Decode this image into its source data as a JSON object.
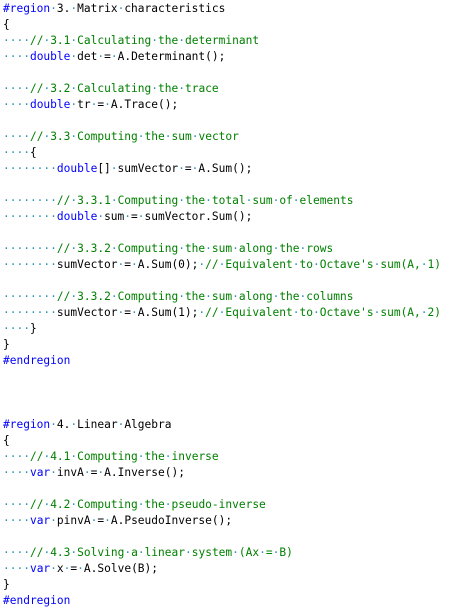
{
  "colors": {
    "keyword": "#0000ff",
    "comment": "#008000",
    "whitespace_marker": "#2b91af",
    "text": "#000000",
    "background": "#ffffff"
  },
  "lines": [
    [
      {
        "t": "kw",
        "v": "#region"
      },
      {
        "t": "ws",
        "v": "·"
      },
      {
        "t": "txt",
        "v": "3."
      },
      {
        "t": "ws",
        "v": "·"
      },
      {
        "t": "txt",
        "v": "Matrix"
      },
      {
        "t": "ws",
        "v": "·"
      },
      {
        "t": "txt",
        "v": "characteristics"
      }
    ],
    [
      {
        "t": "txt",
        "v": "{"
      }
    ],
    [
      {
        "t": "ws",
        "v": "····"
      },
      {
        "t": "cm",
        "v": "//"
      },
      {
        "t": "ws",
        "v": "·"
      },
      {
        "t": "cm",
        "v": "3.1"
      },
      {
        "t": "ws",
        "v": "·"
      },
      {
        "t": "cm",
        "v": "Calculating"
      },
      {
        "t": "ws",
        "v": "·"
      },
      {
        "t": "cm",
        "v": "the"
      },
      {
        "t": "ws",
        "v": "·"
      },
      {
        "t": "cm",
        "v": "determinant"
      }
    ],
    [
      {
        "t": "ws",
        "v": "····"
      },
      {
        "t": "kw",
        "v": "double"
      },
      {
        "t": "ws",
        "v": "·"
      },
      {
        "t": "txt",
        "v": "det"
      },
      {
        "t": "ws",
        "v": "·"
      },
      {
        "t": "txt",
        "v": "="
      },
      {
        "t": "ws",
        "v": "·"
      },
      {
        "t": "txt",
        "v": "A.Determinant();"
      }
    ],
    [],
    [
      {
        "t": "ws",
        "v": "····"
      },
      {
        "t": "cm",
        "v": "//"
      },
      {
        "t": "ws",
        "v": "·"
      },
      {
        "t": "cm",
        "v": "3.2"
      },
      {
        "t": "ws",
        "v": "·"
      },
      {
        "t": "cm",
        "v": "Calculating"
      },
      {
        "t": "ws",
        "v": "·"
      },
      {
        "t": "cm",
        "v": "the"
      },
      {
        "t": "ws",
        "v": "·"
      },
      {
        "t": "cm",
        "v": "trace"
      }
    ],
    [
      {
        "t": "ws",
        "v": "····"
      },
      {
        "t": "kw",
        "v": "double"
      },
      {
        "t": "ws",
        "v": "·"
      },
      {
        "t": "txt",
        "v": "tr"
      },
      {
        "t": "ws",
        "v": "·"
      },
      {
        "t": "txt",
        "v": "="
      },
      {
        "t": "ws",
        "v": "·"
      },
      {
        "t": "txt",
        "v": "A.Trace();"
      }
    ],
    [],
    [
      {
        "t": "ws",
        "v": "····"
      },
      {
        "t": "cm",
        "v": "//"
      },
      {
        "t": "ws",
        "v": "·"
      },
      {
        "t": "cm",
        "v": "3.3"
      },
      {
        "t": "ws",
        "v": "·"
      },
      {
        "t": "cm",
        "v": "Computing"
      },
      {
        "t": "ws",
        "v": "·"
      },
      {
        "t": "cm",
        "v": "the"
      },
      {
        "t": "ws",
        "v": "·"
      },
      {
        "t": "cm",
        "v": "sum"
      },
      {
        "t": "ws",
        "v": "·"
      },
      {
        "t": "cm",
        "v": "vector"
      }
    ],
    [
      {
        "t": "ws",
        "v": "····"
      },
      {
        "t": "txt",
        "v": "{"
      }
    ],
    [
      {
        "t": "ws",
        "v": "········"
      },
      {
        "t": "kw",
        "v": "double"
      },
      {
        "t": "txt",
        "v": "[]"
      },
      {
        "t": "ws",
        "v": "·"
      },
      {
        "t": "txt",
        "v": "sumVector"
      },
      {
        "t": "ws",
        "v": "·"
      },
      {
        "t": "txt",
        "v": "="
      },
      {
        "t": "ws",
        "v": "·"
      },
      {
        "t": "txt",
        "v": "A.Sum();"
      }
    ],
    [],
    [
      {
        "t": "ws",
        "v": "········"
      },
      {
        "t": "cm",
        "v": "//"
      },
      {
        "t": "ws",
        "v": "·"
      },
      {
        "t": "cm",
        "v": "3.3.1"
      },
      {
        "t": "ws",
        "v": "·"
      },
      {
        "t": "cm",
        "v": "Computing"
      },
      {
        "t": "ws",
        "v": "·"
      },
      {
        "t": "cm",
        "v": "the"
      },
      {
        "t": "ws",
        "v": "·"
      },
      {
        "t": "cm",
        "v": "total"
      },
      {
        "t": "ws",
        "v": "·"
      },
      {
        "t": "cm",
        "v": "sum"
      },
      {
        "t": "ws",
        "v": "·"
      },
      {
        "t": "cm",
        "v": "of"
      },
      {
        "t": "ws",
        "v": "·"
      },
      {
        "t": "cm",
        "v": "elements"
      }
    ],
    [
      {
        "t": "ws",
        "v": "········"
      },
      {
        "t": "kw",
        "v": "double"
      },
      {
        "t": "ws",
        "v": "·"
      },
      {
        "t": "txt",
        "v": "sum"
      },
      {
        "t": "ws",
        "v": "·"
      },
      {
        "t": "txt",
        "v": "="
      },
      {
        "t": "ws",
        "v": "·"
      },
      {
        "t": "txt",
        "v": "sumVector.Sum();"
      }
    ],
    [],
    [
      {
        "t": "ws",
        "v": "········"
      },
      {
        "t": "cm",
        "v": "//"
      },
      {
        "t": "ws",
        "v": "·"
      },
      {
        "t": "cm",
        "v": "3.3.2"
      },
      {
        "t": "ws",
        "v": "·"
      },
      {
        "t": "cm",
        "v": "Computing"
      },
      {
        "t": "ws",
        "v": "·"
      },
      {
        "t": "cm",
        "v": "the"
      },
      {
        "t": "ws",
        "v": "·"
      },
      {
        "t": "cm",
        "v": "sum"
      },
      {
        "t": "ws",
        "v": "·"
      },
      {
        "t": "cm",
        "v": "along"
      },
      {
        "t": "ws",
        "v": "·"
      },
      {
        "t": "cm",
        "v": "the"
      },
      {
        "t": "ws",
        "v": "·"
      },
      {
        "t": "cm",
        "v": "rows"
      }
    ],
    [
      {
        "t": "ws",
        "v": "········"
      },
      {
        "t": "txt",
        "v": "sumVector"
      },
      {
        "t": "ws",
        "v": "·"
      },
      {
        "t": "txt",
        "v": "="
      },
      {
        "t": "ws",
        "v": "·"
      },
      {
        "t": "txt",
        "v": "A.Sum(0);"
      },
      {
        "t": "ws",
        "v": "·"
      },
      {
        "t": "cm",
        "v": "//"
      },
      {
        "t": "ws",
        "v": "·"
      },
      {
        "t": "cm",
        "v": "Equivalent"
      },
      {
        "t": "ws",
        "v": "·"
      },
      {
        "t": "cm",
        "v": "to"
      },
      {
        "t": "ws",
        "v": "·"
      },
      {
        "t": "cm",
        "v": "Octave's"
      },
      {
        "t": "ws",
        "v": "·"
      },
      {
        "t": "cm",
        "v": "sum(A,"
      },
      {
        "t": "ws",
        "v": "·"
      },
      {
        "t": "cm",
        "v": "1)"
      }
    ],
    [],
    [
      {
        "t": "ws",
        "v": "········"
      },
      {
        "t": "cm",
        "v": "//"
      },
      {
        "t": "ws",
        "v": "·"
      },
      {
        "t": "cm",
        "v": "3.3.2"
      },
      {
        "t": "ws",
        "v": "·"
      },
      {
        "t": "cm",
        "v": "Computing"
      },
      {
        "t": "ws",
        "v": "·"
      },
      {
        "t": "cm",
        "v": "the"
      },
      {
        "t": "ws",
        "v": "·"
      },
      {
        "t": "cm",
        "v": "sum"
      },
      {
        "t": "ws",
        "v": "·"
      },
      {
        "t": "cm",
        "v": "along"
      },
      {
        "t": "ws",
        "v": "·"
      },
      {
        "t": "cm",
        "v": "the"
      },
      {
        "t": "ws",
        "v": "·"
      },
      {
        "t": "cm",
        "v": "columns"
      }
    ],
    [
      {
        "t": "ws",
        "v": "········"
      },
      {
        "t": "txt",
        "v": "sumVector"
      },
      {
        "t": "ws",
        "v": "·"
      },
      {
        "t": "txt",
        "v": "="
      },
      {
        "t": "ws",
        "v": "·"
      },
      {
        "t": "txt",
        "v": "A.Sum(1);"
      },
      {
        "t": "ws",
        "v": "·"
      },
      {
        "t": "cm",
        "v": "//"
      },
      {
        "t": "ws",
        "v": "·"
      },
      {
        "t": "cm",
        "v": "Equivalent"
      },
      {
        "t": "ws",
        "v": "·"
      },
      {
        "t": "cm",
        "v": "to"
      },
      {
        "t": "ws",
        "v": "·"
      },
      {
        "t": "cm",
        "v": "Octave's"
      },
      {
        "t": "ws",
        "v": "·"
      },
      {
        "t": "cm",
        "v": "sum(A,"
      },
      {
        "t": "ws",
        "v": "·"
      },
      {
        "t": "cm",
        "v": "2)"
      }
    ],
    [
      {
        "t": "ws",
        "v": "····"
      },
      {
        "t": "txt",
        "v": "}"
      }
    ],
    [
      {
        "t": "txt",
        "v": "}"
      }
    ],
    [
      {
        "t": "kw",
        "v": "#endregion"
      }
    ],
    [],
    [],
    [],
    [
      {
        "t": "kw",
        "v": "#region"
      },
      {
        "t": "ws",
        "v": "·"
      },
      {
        "t": "txt",
        "v": "4."
      },
      {
        "t": "ws",
        "v": "·"
      },
      {
        "t": "txt",
        "v": "Linear"
      },
      {
        "t": "ws",
        "v": "·"
      },
      {
        "t": "txt",
        "v": "Algebra"
      }
    ],
    [
      {
        "t": "txt",
        "v": "{"
      }
    ],
    [
      {
        "t": "ws",
        "v": "····"
      },
      {
        "t": "cm",
        "v": "//"
      },
      {
        "t": "ws",
        "v": "·"
      },
      {
        "t": "cm",
        "v": "4.1"
      },
      {
        "t": "ws",
        "v": "·"
      },
      {
        "t": "cm",
        "v": "Computing"
      },
      {
        "t": "ws",
        "v": "·"
      },
      {
        "t": "cm",
        "v": "the"
      },
      {
        "t": "ws",
        "v": "·"
      },
      {
        "t": "cm",
        "v": "inverse"
      }
    ],
    [
      {
        "t": "ws",
        "v": "····"
      },
      {
        "t": "kw",
        "v": "var"
      },
      {
        "t": "ws",
        "v": "·"
      },
      {
        "t": "txt",
        "v": "invA"
      },
      {
        "t": "ws",
        "v": "·"
      },
      {
        "t": "txt",
        "v": "="
      },
      {
        "t": "ws",
        "v": "·"
      },
      {
        "t": "txt",
        "v": "A.Inverse();"
      }
    ],
    [],
    [
      {
        "t": "ws",
        "v": "····"
      },
      {
        "t": "cm",
        "v": "//"
      },
      {
        "t": "ws",
        "v": "·"
      },
      {
        "t": "cm",
        "v": "4.2"
      },
      {
        "t": "ws",
        "v": "·"
      },
      {
        "t": "cm",
        "v": "Computing"
      },
      {
        "t": "ws",
        "v": "·"
      },
      {
        "t": "cm",
        "v": "the"
      },
      {
        "t": "ws",
        "v": "·"
      },
      {
        "t": "cm",
        "v": "pseudo-inverse"
      }
    ],
    [
      {
        "t": "ws",
        "v": "····"
      },
      {
        "t": "kw",
        "v": "var"
      },
      {
        "t": "ws",
        "v": "·"
      },
      {
        "t": "txt",
        "v": "pinvA"
      },
      {
        "t": "ws",
        "v": "·"
      },
      {
        "t": "txt",
        "v": "="
      },
      {
        "t": "ws",
        "v": "·"
      },
      {
        "t": "txt",
        "v": "A.PseudoInverse();"
      }
    ],
    [],
    [
      {
        "t": "ws",
        "v": "····"
      },
      {
        "t": "cm",
        "v": "//"
      },
      {
        "t": "ws",
        "v": "·"
      },
      {
        "t": "cm",
        "v": "4.3"
      },
      {
        "t": "ws",
        "v": "·"
      },
      {
        "t": "cm",
        "v": "Solving"
      },
      {
        "t": "ws",
        "v": "·"
      },
      {
        "t": "cm",
        "v": "a"
      },
      {
        "t": "ws",
        "v": "·"
      },
      {
        "t": "cm",
        "v": "linear"
      },
      {
        "t": "ws",
        "v": "·"
      },
      {
        "t": "cm",
        "v": "system"
      },
      {
        "t": "ws",
        "v": "·"
      },
      {
        "t": "cm",
        "v": "(Ax"
      },
      {
        "t": "ws",
        "v": "·"
      },
      {
        "t": "cm",
        "v": "="
      },
      {
        "t": "ws",
        "v": "·"
      },
      {
        "t": "cm",
        "v": "B)"
      }
    ],
    [
      {
        "t": "ws",
        "v": "····"
      },
      {
        "t": "kw",
        "v": "var"
      },
      {
        "t": "ws",
        "v": "·"
      },
      {
        "t": "txt",
        "v": "x"
      },
      {
        "t": "ws",
        "v": "·"
      },
      {
        "t": "txt",
        "v": "="
      },
      {
        "t": "ws",
        "v": "·"
      },
      {
        "t": "txt",
        "v": "A.Solve(B);"
      }
    ],
    [
      {
        "t": "txt",
        "v": "}"
      }
    ],
    [
      {
        "t": "kw",
        "v": "#endregion"
      }
    ]
  ]
}
